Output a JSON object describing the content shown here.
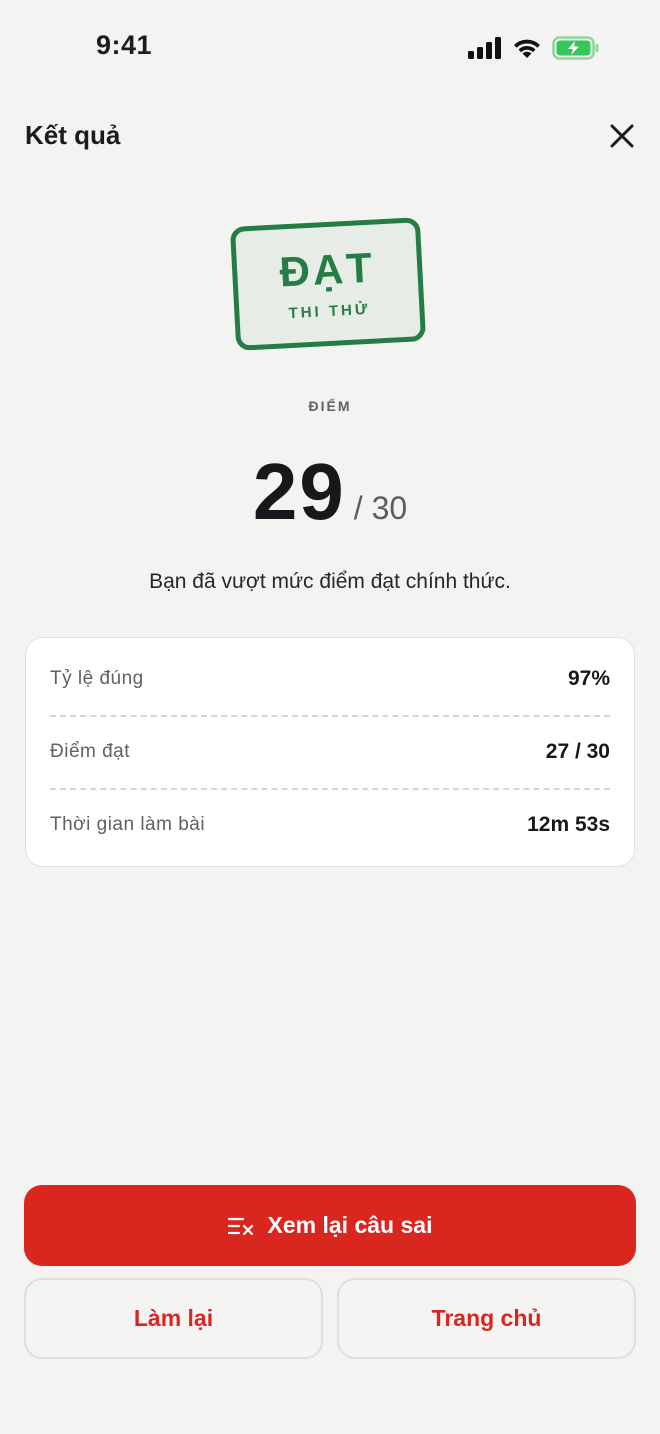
{
  "status_bar": {
    "time": "9:41"
  },
  "header": {
    "title": "Kết quả"
  },
  "stamp": {
    "main": "ĐẠT",
    "sub": "THI THỬ"
  },
  "score": {
    "label": "ĐIỂM",
    "value": "29",
    "total": "/ 30",
    "message": "Bạn đã vượt mức điểm đạt chính thức."
  },
  "stats": [
    {
      "label": "Tỷ lệ đúng",
      "value": "97%"
    },
    {
      "label": "Điểm đạt",
      "value": "27 / 30"
    },
    {
      "label": "Thời gian làm bài",
      "value": "12m 53s"
    }
  ],
  "actions": {
    "review_label": "Xem lại câu sai",
    "retry_label": "Làm lại",
    "home_label": "Trang chủ"
  },
  "colors": {
    "accent_red": "#d9261f",
    "stamp_green": "#257d45",
    "battery_green": "#34c759"
  },
  "icons": {
    "status": [
      "cellular-signal-icon",
      "wifi-icon",
      "battery-charging-icon"
    ],
    "close": "close-icon",
    "review": "list-x-icon"
  }
}
